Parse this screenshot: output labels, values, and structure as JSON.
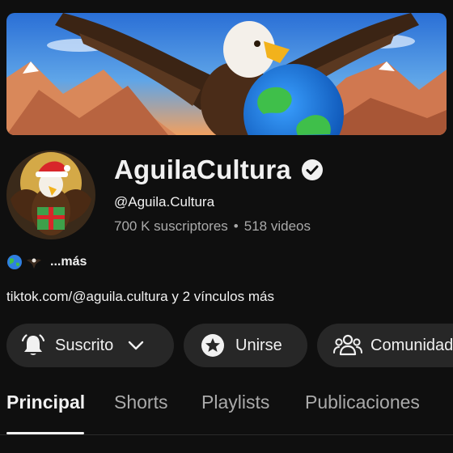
{
  "channel": {
    "name": "AguilaCultura",
    "handle": "@Aguila.Cultura",
    "subscribers": "700 K suscriptores",
    "separator": "•",
    "videos": "518 videos",
    "description_more": "...más",
    "links": "tiktok.com/@aguila.cultura y 2 vínculos más"
  },
  "actions": {
    "subscribed_label": "Suscrito",
    "join_label": "Unirse",
    "community_label": "Comunidad"
  },
  "tabs": [
    {
      "label": "Principal",
      "active": true
    },
    {
      "label": "Shorts",
      "active": false
    },
    {
      "label": "Playlists",
      "active": false
    },
    {
      "label": "Publicaciones",
      "active": false
    }
  ],
  "icons": {
    "verified": "verified-check-icon",
    "bell": "bell-icon",
    "chevron": "chevron-down-icon",
    "star": "star-icon",
    "community": "people-icon",
    "globe": "globe-emoji",
    "eagle": "eagle-emoji"
  },
  "colors": {
    "background": "#0f0f0f",
    "pill": "#272727",
    "text": "#f1f1f1",
    "muted": "#aaaaaa"
  }
}
